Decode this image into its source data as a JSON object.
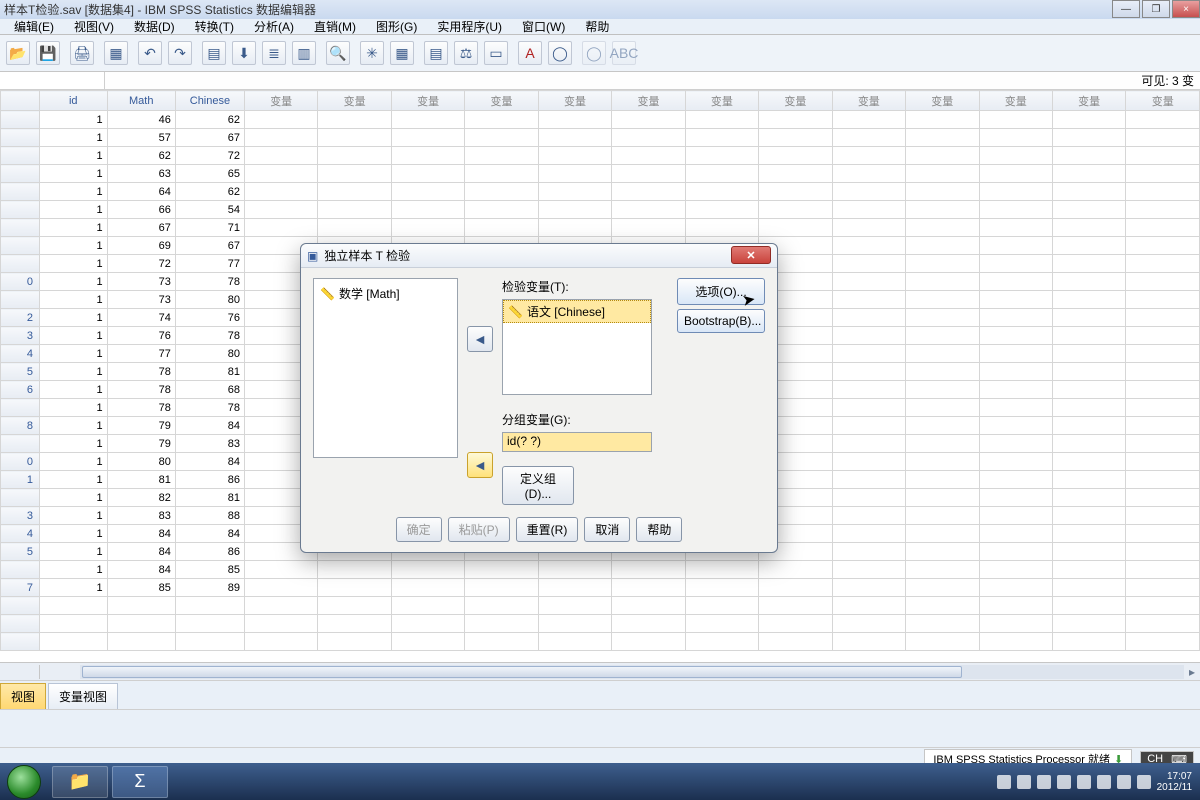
{
  "window": {
    "title": "样本T检验.sav [数据集4] - IBM SPSS Statistics 数据编辑器"
  },
  "menu": [
    "编辑(E)",
    "视图(V)",
    "数据(D)",
    "转换(T)",
    "分析(A)",
    "直销(M)",
    "图形(G)",
    "实用程序(U)",
    "窗口(W)",
    "帮助"
  ],
  "indicator_right": "可见: 3 变",
  "columns": [
    "id",
    "Math",
    "Chinese",
    "变量",
    "变量",
    "变量",
    "变量",
    "变量",
    "变量",
    "变量",
    "变量",
    "变量",
    "变量",
    "变量",
    "变量",
    "变量"
  ],
  "rows": [
    {
      "n": "",
      "id": 1,
      "Math": 46,
      "Chinese": 62
    },
    {
      "n": "",
      "id": 1,
      "Math": 57,
      "Chinese": 67
    },
    {
      "n": "",
      "id": 1,
      "Math": 62,
      "Chinese": 72
    },
    {
      "n": "",
      "id": 1,
      "Math": 63,
      "Chinese": 65
    },
    {
      "n": "",
      "id": 1,
      "Math": 64,
      "Chinese": 62
    },
    {
      "n": "",
      "id": 1,
      "Math": 66,
      "Chinese": 54
    },
    {
      "n": "",
      "id": 1,
      "Math": 67,
      "Chinese": 71
    },
    {
      "n": "",
      "id": 1,
      "Math": 69,
      "Chinese": 67
    },
    {
      "n": "",
      "id": 1,
      "Math": 72,
      "Chinese": 77
    },
    {
      "n": "0",
      "id": 1,
      "Math": 73,
      "Chinese": 78
    },
    {
      "n": "",
      "id": 1,
      "Math": 73,
      "Chinese": 80
    },
    {
      "n": "2",
      "id": 1,
      "Math": 74,
      "Chinese": 76
    },
    {
      "n": "3",
      "id": 1,
      "Math": 76,
      "Chinese": 78
    },
    {
      "n": "4",
      "id": 1,
      "Math": 77,
      "Chinese": 80
    },
    {
      "n": "5",
      "id": 1,
      "Math": 78,
      "Chinese": 81
    },
    {
      "n": "6",
      "id": 1,
      "Math": 78,
      "Chinese": 68
    },
    {
      "n": "",
      "id": 1,
      "Math": 78,
      "Chinese": 78
    },
    {
      "n": "8",
      "id": 1,
      "Math": 79,
      "Chinese": 84
    },
    {
      "n": "",
      "id": 1,
      "Math": 79,
      "Chinese": 83
    },
    {
      "n": "0",
      "id": 1,
      "Math": 80,
      "Chinese": 84
    },
    {
      "n": "1",
      "id": 1,
      "Math": 81,
      "Chinese": 86
    },
    {
      "n": "",
      "id": 1,
      "Math": 82,
      "Chinese": 81
    },
    {
      "n": "3",
      "id": 1,
      "Math": 83,
      "Chinese": 88
    },
    {
      "n": "4",
      "id": 1,
      "Math": 84,
      "Chinese": 84
    },
    {
      "n": "5",
      "id": 1,
      "Math": 84,
      "Chinese": 86
    },
    {
      "n": "",
      "id": 1,
      "Math": 84,
      "Chinese": 85
    },
    {
      "n": "7",
      "id": 1,
      "Math": 85,
      "Chinese": 89
    }
  ],
  "tabs": {
    "data": "视图",
    "var": "变量视图"
  },
  "status": {
    "processor": "IBM SPSS Statistics Processor 就绪",
    "ime": "CH"
  },
  "taskbar": {
    "time": "17:07",
    "date": "2012/11"
  },
  "dialog": {
    "title": "独立样本 T 检验",
    "source_items": [
      "数学 [Math]"
    ],
    "test_label": "检验变量(T):",
    "test_items": [
      "语文 [Chinese]"
    ],
    "group_label": "分组变量(G):",
    "group_value": "id(? ?)",
    "define_groups": "定义组(D)...",
    "options": "选项(O)...",
    "bootstrap": "Bootstrap(B)...",
    "buttons": {
      "ok": "确定",
      "paste": "粘贴(P)",
      "reset": "重置(R)",
      "cancel": "取消",
      "help": "帮助"
    }
  }
}
